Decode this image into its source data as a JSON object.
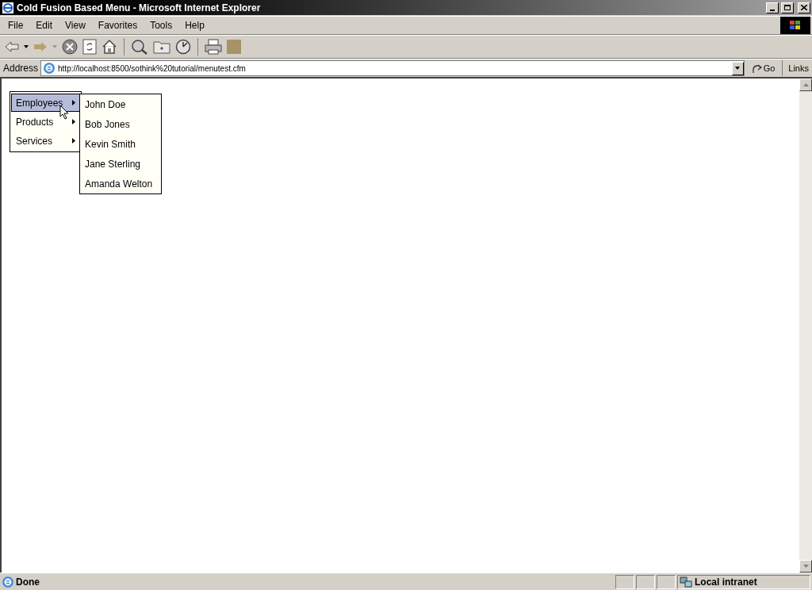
{
  "window": {
    "title": "Cold Fusion Based Menu - Microsoft Internet Explorer"
  },
  "menu_bar": [
    "File",
    "Edit",
    "View",
    "Favorites",
    "Tools",
    "Help"
  ],
  "address_bar": {
    "label": "Address",
    "value": "http://localhost:8500/sothink%20tutorial/menutest.cfm",
    "go": "Go",
    "links": "Links"
  },
  "menu": {
    "items": [
      {
        "label": "Employees",
        "selected": true
      },
      {
        "label": "Products",
        "selected": false
      },
      {
        "label": "Services",
        "selected": false
      }
    ],
    "submenu": [
      "John Doe",
      "Bob Jones",
      "Kevin Smith",
      "Jane Sterling",
      "Amanda Welton"
    ]
  },
  "status_bar": {
    "text": "Done",
    "zone": "Local intranet"
  }
}
